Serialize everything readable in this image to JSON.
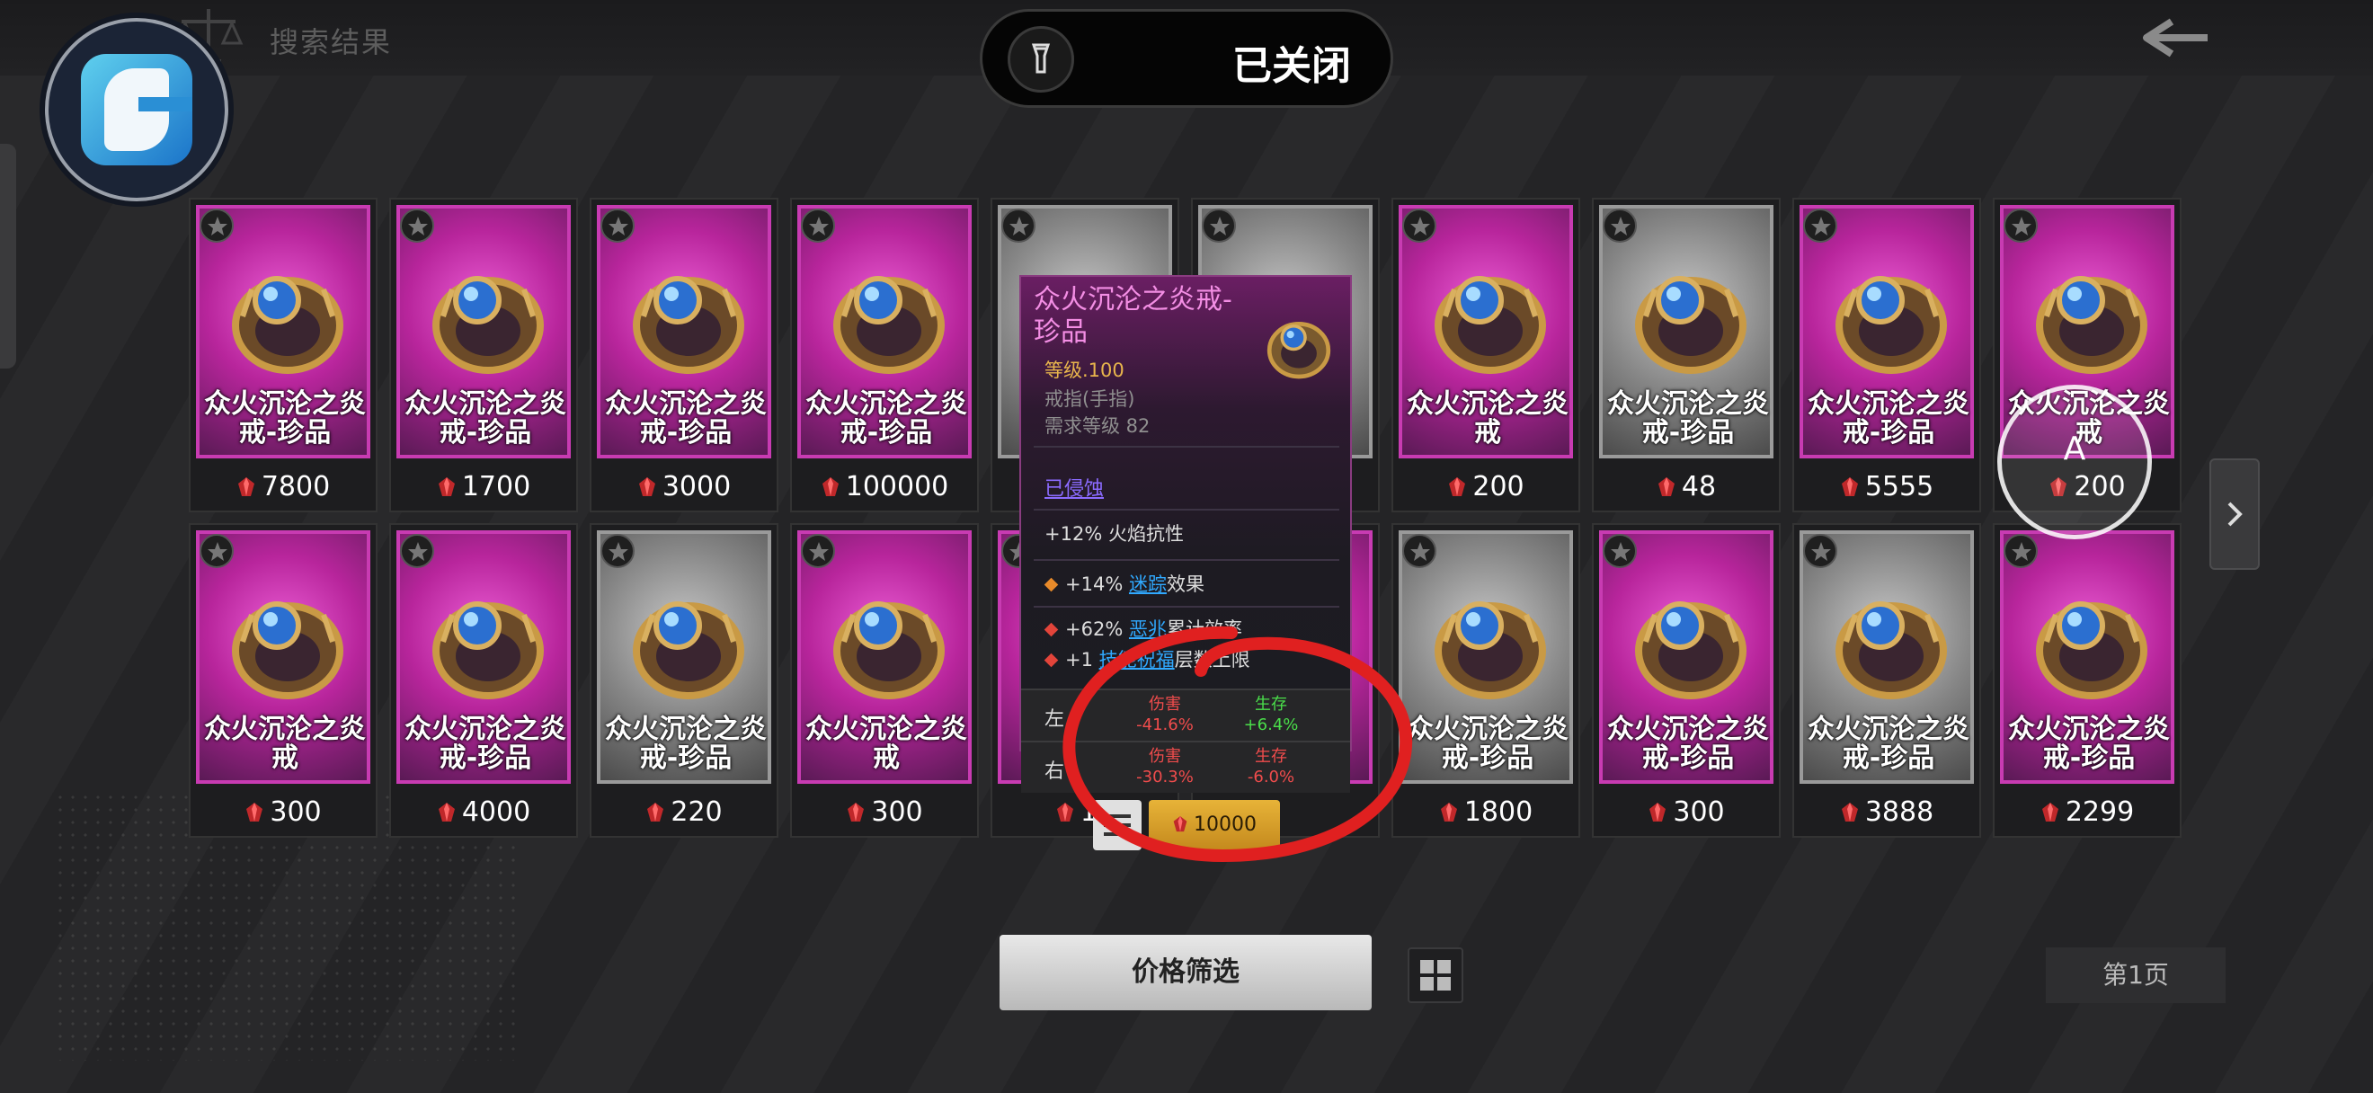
{
  "header": {
    "search_title": "搜索结果",
    "toggle_label": "已关闭"
  },
  "colors": {
    "magenta": "#c83bb2",
    "gold": "#e7b338",
    "red": "#f04c4c",
    "green": "#4ade4a",
    "annotation": "#e02020"
  },
  "cards": [
    {
      "name": "众火沉沦之炎戒-珍品",
      "price": "7800",
      "rarity": "magenta"
    },
    {
      "name": "众火沉沦之炎戒-珍品",
      "price": "1700",
      "rarity": "magenta"
    },
    {
      "name": "众火沉沦之炎戒-珍品",
      "price": "3000",
      "rarity": "magenta"
    },
    {
      "name": "众火沉沦之炎戒-珍品",
      "price": "100000",
      "rarity": "magenta"
    },
    {
      "name": "",
      "price": "",
      "rarity": "grey"
    },
    {
      "name": "",
      "price": "",
      "rarity": "grey"
    },
    {
      "name": "众火沉沦之炎戒",
      "price": "200",
      "rarity": "magenta"
    },
    {
      "name": "众火沉沦之炎戒-珍品",
      "price": "48",
      "rarity": "grey"
    },
    {
      "name": "众火沉沦之炎戒-珍品",
      "price": "5555",
      "rarity": "magenta"
    },
    {
      "name": "众火沉沦之炎戒",
      "price": "200",
      "rarity": "magenta"
    },
    {
      "name": "众火沉沦之炎戒",
      "price": "300",
      "rarity": "magenta"
    },
    {
      "name": "众火沉沦之炎戒-珍品",
      "price": "4000",
      "rarity": "magenta"
    },
    {
      "name": "众火沉沦之炎戒-珍品",
      "price": "220",
      "rarity": "grey"
    },
    {
      "name": "众火沉沦之炎戒",
      "price": "300",
      "rarity": "magenta"
    },
    {
      "name": "",
      "price": "10",
      "rarity": "magenta"
    },
    {
      "name": "",
      "price": "",
      "rarity": "magenta"
    },
    {
      "name": "众火沉沦之炎戒-珍品",
      "price": "1800",
      "rarity": "grey"
    },
    {
      "name": "众火沉沦之炎戒-珍品",
      "price": "300",
      "rarity": "magenta"
    },
    {
      "name": "众火沉沦之炎戒-珍品",
      "price": "3888",
      "rarity": "grey"
    },
    {
      "name": "众火沉沦之炎戒-珍品",
      "price": "2299",
      "rarity": "magenta"
    }
  ],
  "tooltip": {
    "title": "众火沉沦之炎戒-珍品",
    "level": "等级.100",
    "type": "戒指(手指)",
    "requirement": "需求等级 82",
    "corrupted": "已侵蚀",
    "implicit": "+12% 火焰抗性",
    "mod1_prefix": "+14% ",
    "mod1_link": "迷踪",
    "mod1_suffix": "效果",
    "mod2_prefix": "+62% ",
    "mod2_link": "恶兆",
    "mod2_suffix": "累计效率",
    "mod3_prefix": "+1 ",
    "mod3_link": "技能祝福",
    "mod3_suffix": "层数上限",
    "compare": [
      {
        "side": "左",
        "damage_label": "伤害",
        "damage": "-41.6%",
        "survival_label": "生存",
        "survival": "+6.4%"
      },
      {
        "side": "右",
        "damage_label": "伤害",
        "damage": "-30.3%",
        "survival_label": "生存",
        "survival": "-6.0%"
      }
    ],
    "buy_price": "10000"
  },
  "footer": {
    "filter_label": "价格筛选",
    "page_label": "第1页"
  },
  "cursor": {
    "label": "A"
  }
}
